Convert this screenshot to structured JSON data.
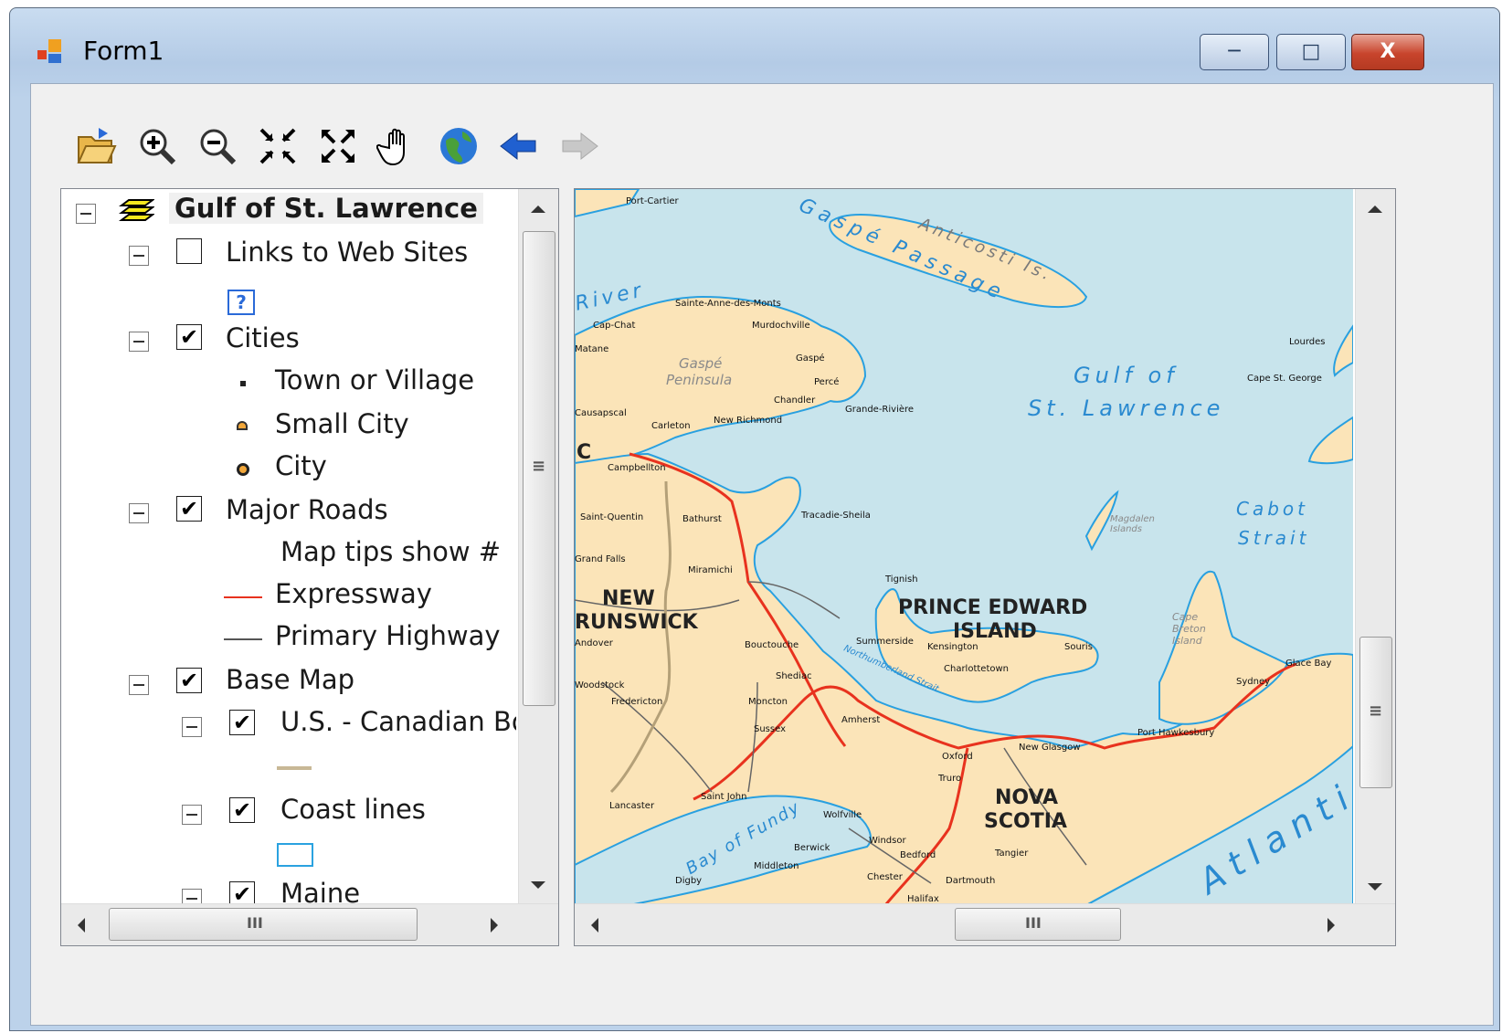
{
  "window": {
    "title": "Form1",
    "minimize": "─",
    "maximize": "□",
    "close": "X"
  },
  "toolbar": {
    "items": [
      "open-icon",
      "zoom-in-icon",
      "zoom-out-icon",
      "fixed-zoom-in-icon",
      "fixed-zoom-out-icon",
      "pan-icon",
      "full-extent-icon",
      "back-icon",
      "forward-icon"
    ]
  },
  "toc": {
    "root": "Gulf of St. Lawrence",
    "links_layer": "Links to Web Sites",
    "cities_layer": "Cities",
    "town": "Town or Village",
    "small_city": "Small City",
    "city": "City",
    "roads_layer": "Major Roads",
    "map_tips": "Map tips show #",
    "expressway": "Expressway",
    "primary_highway": "Primary Highway",
    "basemap_layer": "Base Map",
    "border_layer": "U.S. - Canadian Bo",
    "coast_layer": "Coast lines",
    "maine_layer": "Maine",
    "check_mark": "✔",
    "hscroll_grip": "III",
    "vscroll_grip": "≡"
  },
  "map": {
    "labels": {
      "anticosti": "Anticosti Is.",
      "gaspe_passage": "Gaspé Passage",
      "gulf": "Gulf of",
      "st_lawrence": "St. Lawrence",
      "cabot": "Cabot",
      "strait": "Strait",
      "river": "River",
      "gaspe": "Gaspé",
      "peninsula": "Peninsula",
      "pei1": "PRINCE EDWARD",
      "pei2": "ISLAND",
      "nb1": "NEW",
      "nb2": "RUNSWICK",
      "ns1": "NOVA",
      "ns2": "SCOTIA",
      "atlantic": "Atlantic",
      "bay_of_fundy": "Bay of Fundy",
      "magdalen": "Magdalen Islands",
      "cape_breton": "Cape Breton Island",
      "northumberland": "Northumberland Strait",
      "qc": "C"
    },
    "towns": [
      "Port-Cartier",
      "Sainte-Anne-des-Monts",
      "Cap-Chat",
      "Murdochville",
      "Matane",
      "Gaspé",
      "Percé",
      "Chandler",
      "Grande-Rivière",
      "Causapscal",
      "Carleton",
      "New Richmond",
      "Campbellton",
      "Saint-Quentin",
      "Bathurst",
      "Tracadie-Sheila",
      "Miramichi",
      "Bouctouche",
      "Shediac",
      "Moncton",
      "Sussex",
      "Fredericton",
      "Saint John",
      "Lancaster",
      "Amherst",
      "Truro",
      "Oxford",
      "New Glasgow",
      "Port Hawkesbury",
      "Sydney",
      "Glace Bay",
      "Lourdes",
      "Cape St. George",
      "Tignish",
      "Summerside",
      "Charlottetown",
      "Souris",
      "Wolfville",
      "Windsor",
      "Halifax",
      "Dartmouth",
      "Digby",
      "Middleton",
      "Chester",
      "Tangier",
      "Kensington",
      "Berwick",
      "Bedford",
      "Grand Falls",
      "Andover",
      "Woodstock"
    ]
  }
}
